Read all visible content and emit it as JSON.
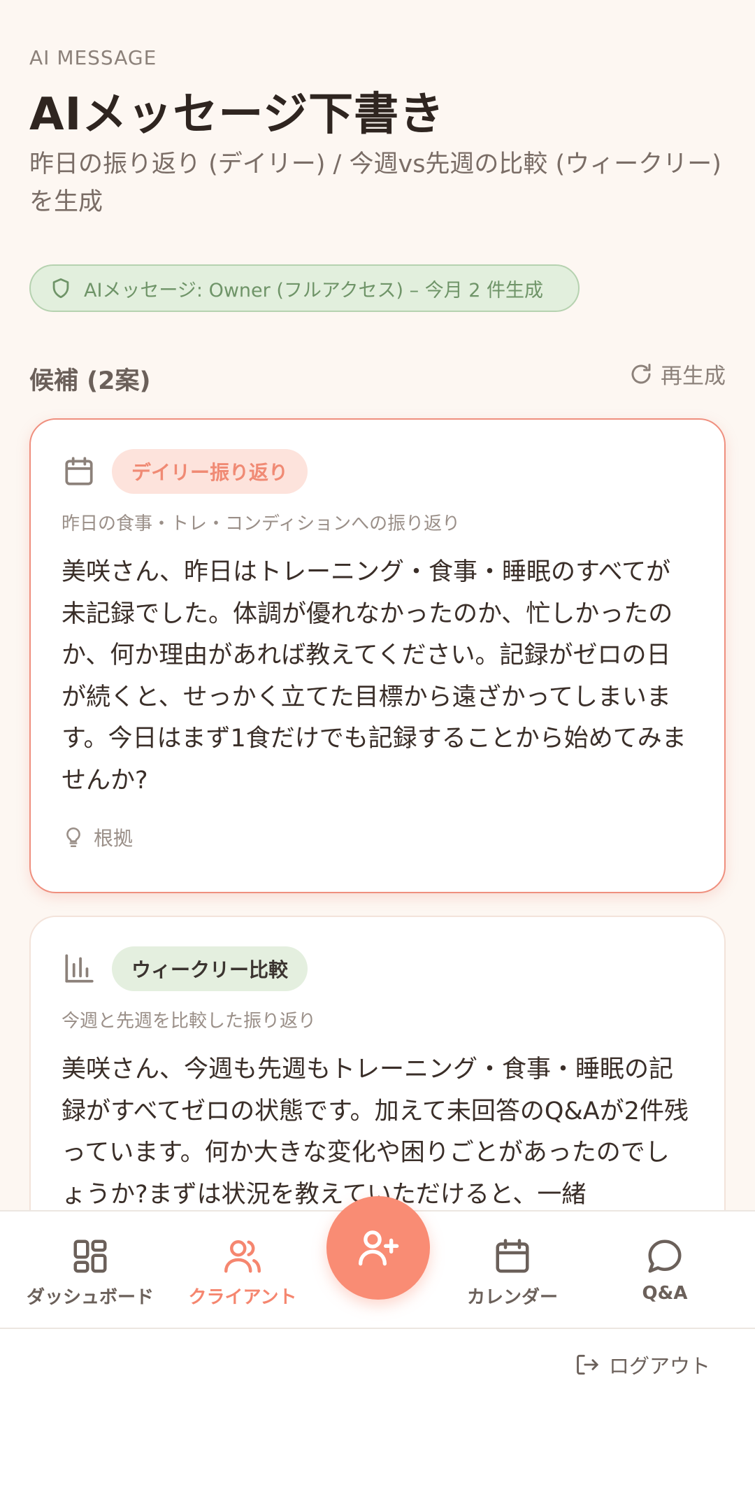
{
  "header": {
    "eyebrow": "AI MESSAGE",
    "title": "AIメッセージ下書き",
    "subtitle": "昨日の振り返り (デイリー) / 今週vs先週の比較 (ウィークリー) を生成"
  },
  "access_badge": {
    "icon": "shield-icon",
    "text": "AIメッセージ: Owner (フルアクセス) – 今月 2 件生成"
  },
  "candidates": {
    "title": "候補 (2案)",
    "regenerate_label": "再生成",
    "items": [
      {
        "icon": "calendar-icon",
        "tag": "デイリー振り返り",
        "description": "昨日の食事・トレ・コンディションへの振り返り",
        "body": "美咲さん、昨日はトレーニング・食事・睡眠のすべてが未記録でした。体調が優れなかったのか、忙しかったのか、何か理由があれば教えてください。記録がゼロの日が続くと、せっかく立てた目標から遠ざかってしまいます。今日はまず1食だけでも記録することから始めてみませんか?",
        "evidence_label": "根拠"
      },
      {
        "icon": "bar-chart-icon",
        "tag": "ウィークリー比較",
        "description": "今週と先週を比較した振り返り",
        "body": "美咲さん、今週も先週もトレーニング・食事・睡眠の記録がすべてゼロの状態です。加えて未回答のQ&Aが2件残っています。何か大きな変化や困りごとがあったのでしょうか?まずは状況を教えていただけると、一緒"
      }
    ]
  },
  "nav": {
    "items": [
      {
        "label": "ダッシュボード",
        "icon": "dashboard-icon"
      },
      {
        "label": "クライアント",
        "icon": "users-icon"
      },
      {
        "label": "カレンダー",
        "icon": "calendar-icon"
      },
      {
        "label": "Q&A",
        "icon": "chat-icon"
      }
    ],
    "fab_icon": "user-plus-icon"
  },
  "footer": {
    "logout_label": "ログアウト"
  },
  "colors": {
    "accent": "#f98c74",
    "background": "#fdf7f2",
    "badge_green": "#e2efdd",
    "text_dark": "#2f2520"
  }
}
